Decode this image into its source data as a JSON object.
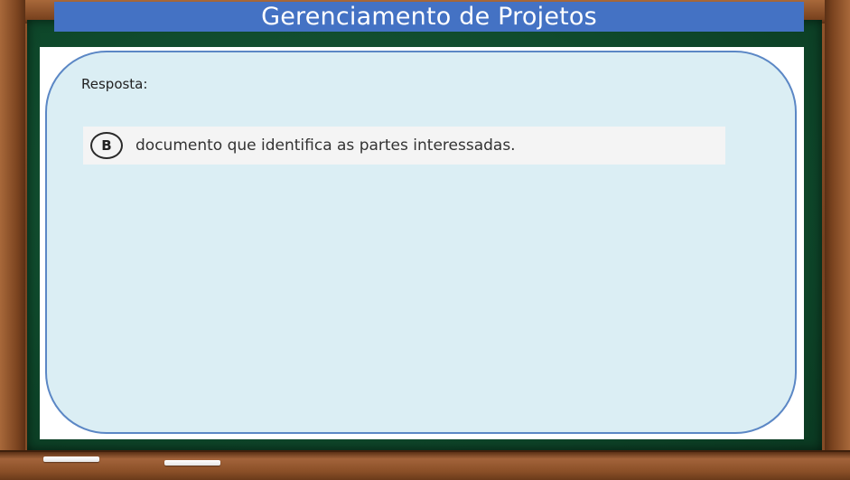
{
  "title": "Gerenciamento de Projetos",
  "content": {
    "label": "Resposta:",
    "answer": {
      "letter": "B",
      "text": "documento que identifica as partes interessadas."
    }
  },
  "colors": {
    "title_bar": "#4472c4",
    "box_fill": "#dbeef4",
    "box_border": "#5b87c5",
    "chalkboard": "#0f4a2c",
    "frame_wood": "#8e5229"
  }
}
